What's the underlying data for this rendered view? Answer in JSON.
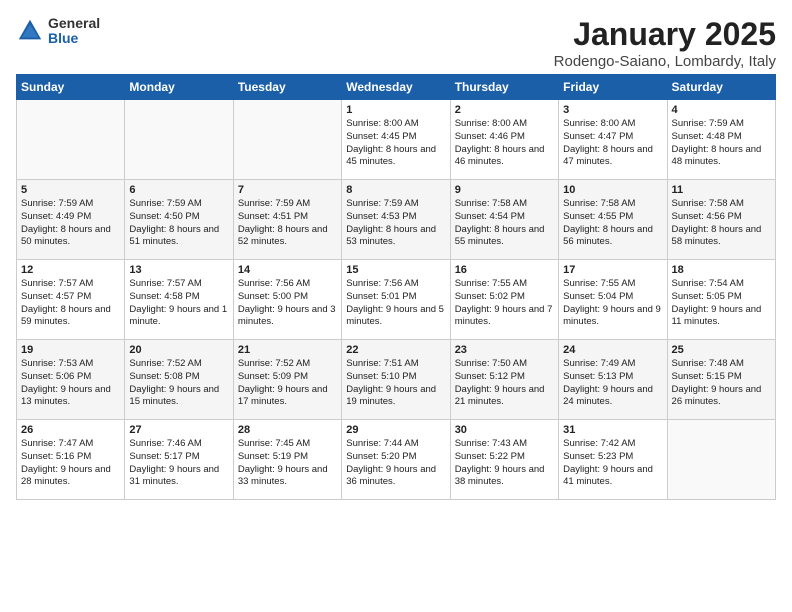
{
  "logo": {
    "general": "General",
    "blue": "Blue"
  },
  "title": "January 2025",
  "subtitle": "Rodengo-Saiano, Lombardy, Italy",
  "weekdays": [
    "Sunday",
    "Monday",
    "Tuesday",
    "Wednesday",
    "Thursday",
    "Friday",
    "Saturday"
  ],
  "weeks": [
    [
      {
        "day": "",
        "info": ""
      },
      {
        "day": "",
        "info": ""
      },
      {
        "day": "",
        "info": ""
      },
      {
        "day": "1",
        "info": "Sunrise: 8:00 AM\nSunset: 4:45 PM\nDaylight: 8 hours and 45 minutes."
      },
      {
        "day": "2",
        "info": "Sunrise: 8:00 AM\nSunset: 4:46 PM\nDaylight: 8 hours and 46 minutes."
      },
      {
        "day": "3",
        "info": "Sunrise: 8:00 AM\nSunset: 4:47 PM\nDaylight: 8 hours and 47 minutes."
      },
      {
        "day": "4",
        "info": "Sunrise: 7:59 AM\nSunset: 4:48 PM\nDaylight: 8 hours and 48 minutes."
      }
    ],
    [
      {
        "day": "5",
        "info": "Sunrise: 7:59 AM\nSunset: 4:49 PM\nDaylight: 8 hours and 50 minutes."
      },
      {
        "day": "6",
        "info": "Sunrise: 7:59 AM\nSunset: 4:50 PM\nDaylight: 8 hours and 51 minutes."
      },
      {
        "day": "7",
        "info": "Sunrise: 7:59 AM\nSunset: 4:51 PM\nDaylight: 8 hours and 52 minutes."
      },
      {
        "day": "8",
        "info": "Sunrise: 7:59 AM\nSunset: 4:53 PM\nDaylight: 8 hours and 53 minutes."
      },
      {
        "day": "9",
        "info": "Sunrise: 7:58 AM\nSunset: 4:54 PM\nDaylight: 8 hours and 55 minutes."
      },
      {
        "day": "10",
        "info": "Sunrise: 7:58 AM\nSunset: 4:55 PM\nDaylight: 8 hours and 56 minutes."
      },
      {
        "day": "11",
        "info": "Sunrise: 7:58 AM\nSunset: 4:56 PM\nDaylight: 8 hours and 58 minutes."
      }
    ],
    [
      {
        "day": "12",
        "info": "Sunrise: 7:57 AM\nSunset: 4:57 PM\nDaylight: 8 hours and 59 minutes."
      },
      {
        "day": "13",
        "info": "Sunrise: 7:57 AM\nSunset: 4:58 PM\nDaylight: 9 hours and 1 minute."
      },
      {
        "day": "14",
        "info": "Sunrise: 7:56 AM\nSunset: 5:00 PM\nDaylight: 9 hours and 3 minutes."
      },
      {
        "day": "15",
        "info": "Sunrise: 7:56 AM\nSunset: 5:01 PM\nDaylight: 9 hours and 5 minutes."
      },
      {
        "day": "16",
        "info": "Sunrise: 7:55 AM\nSunset: 5:02 PM\nDaylight: 9 hours and 7 minutes."
      },
      {
        "day": "17",
        "info": "Sunrise: 7:55 AM\nSunset: 5:04 PM\nDaylight: 9 hours and 9 minutes."
      },
      {
        "day": "18",
        "info": "Sunrise: 7:54 AM\nSunset: 5:05 PM\nDaylight: 9 hours and 11 minutes."
      }
    ],
    [
      {
        "day": "19",
        "info": "Sunrise: 7:53 AM\nSunset: 5:06 PM\nDaylight: 9 hours and 13 minutes."
      },
      {
        "day": "20",
        "info": "Sunrise: 7:52 AM\nSunset: 5:08 PM\nDaylight: 9 hours and 15 minutes."
      },
      {
        "day": "21",
        "info": "Sunrise: 7:52 AM\nSunset: 5:09 PM\nDaylight: 9 hours and 17 minutes."
      },
      {
        "day": "22",
        "info": "Sunrise: 7:51 AM\nSunset: 5:10 PM\nDaylight: 9 hours and 19 minutes."
      },
      {
        "day": "23",
        "info": "Sunrise: 7:50 AM\nSunset: 5:12 PM\nDaylight: 9 hours and 21 minutes."
      },
      {
        "day": "24",
        "info": "Sunrise: 7:49 AM\nSunset: 5:13 PM\nDaylight: 9 hours and 24 minutes."
      },
      {
        "day": "25",
        "info": "Sunrise: 7:48 AM\nSunset: 5:15 PM\nDaylight: 9 hours and 26 minutes."
      }
    ],
    [
      {
        "day": "26",
        "info": "Sunrise: 7:47 AM\nSunset: 5:16 PM\nDaylight: 9 hours and 28 minutes."
      },
      {
        "day": "27",
        "info": "Sunrise: 7:46 AM\nSunset: 5:17 PM\nDaylight: 9 hours and 31 minutes."
      },
      {
        "day": "28",
        "info": "Sunrise: 7:45 AM\nSunset: 5:19 PM\nDaylight: 9 hours and 33 minutes."
      },
      {
        "day": "29",
        "info": "Sunrise: 7:44 AM\nSunset: 5:20 PM\nDaylight: 9 hours and 36 minutes."
      },
      {
        "day": "30",
        "info": "Sunrise: 7:43 AM\nSunset: 5:22 PM\nDaylight: 9 hours and 38 minutes."
      },
      {
        "day": "31",
        "info": "Sunrise: 7:42 AM\nSunset: 5:23 PM\nDaylight: 9 hours and 41 minutes."
      },
      {
        "day": "",
        "info": ""
      }
    ]
  ]
}
